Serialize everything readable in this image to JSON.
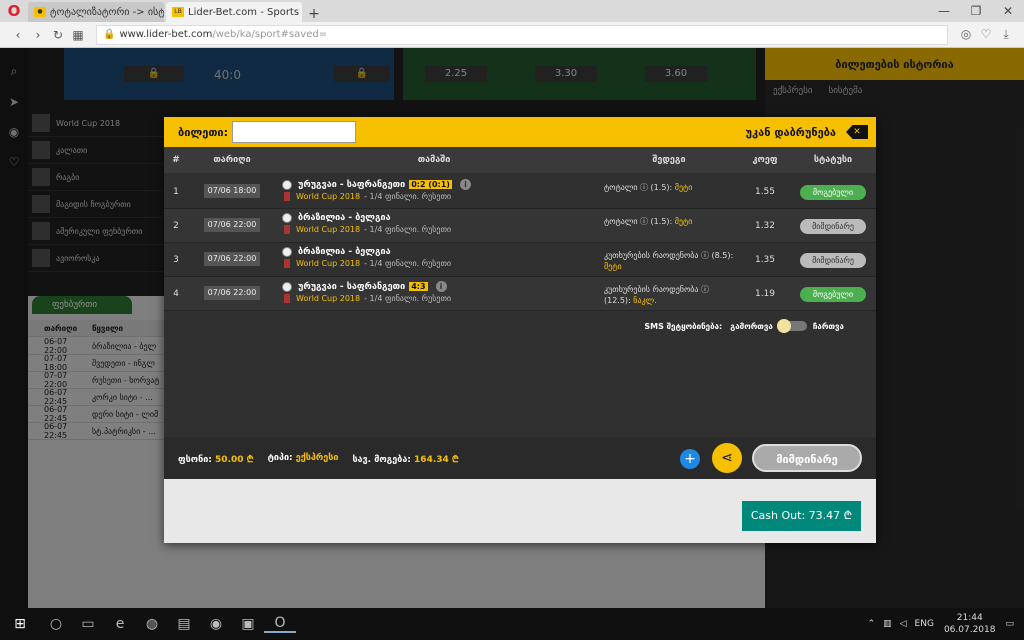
{
  "browser": {
    "tabs": [
      {
        "title": "ტოტალიზატორი -> ისტ",
        "active": false
      },
      {
        "title": "Lider-Bet.com - Sports and",
        "active": true
      }
    ],
    "url_host": "www.lider-bet.com",
    "url_path": "/web/ka/sport#saved="
  },
  "background": {
    "banner_left_score": "40:0",
    "banner_mid_odds": [
      "2.25",
      "3.30",
      "3.60"
    ],
    "ticket_history": "ბილეთების ისტორია",
    "right_tabs": [
      "ექსპრესი",
      "სისტემა"
    ],
    "sports": [
      "World Cup 2018",
      "კალათი",
      "რაგბი",
      "მაგიდის ჩოგბურთი",
      "ამერიკული ფეხბურთი",
      "ავიოროსკა"
    ],
    "football_tab": "ფეხბურთი",
    "table_head": [
      "თარიღი",
      "წყვილი"
    ],
    "rows": [
      {
        "d": "06-07 22:00",
        "t": "ბრაზილია - ბელ"
      },
      {
        "d": "07-07 18:00",
        "t": "შვედეთი - ინგლ"
      },
      {
        "d": "07-07 22:00",
        "t": "რუსეთი - ხორვატ"
      },
      {
        "d": "06-07 22:45",
        "t": "კორკი სიტი - ..."
      },
      {
        "d": "06-07 22:45",
        "t": "დერი სიტი - ლიმ"
      },
      {
        "d": "06-07 22:45",
        "t": "სტ.პატრიკსი - ..."
      }
    ]
  },
  "modal": {
    "ticket_label": "ბილეთი:",
    "back_label": "უკან დაბრუნება",
    "columns": [
      "#",
      "თარიღი",
      "თამაში",
      "შედეგი",
      "კოეფ",
      "სტატუსი"
    ],
    "rows": [
      {
        "num": "1",
        "date": "07/06 18:00",
        "match": "ურუგვაი - საფრანგეთი",
        "score": "0:2 (0:1)",
        "league": "World Cup 2018",
        "round": "- 1/4 ფინალი. რუსეთი",
        "bet": "ტოტალი ⓘ (1.5):",
        "result": "მეტი",
        "odds": "1.55",
        "status": "მოგებული",
        "state": "won"
      },
      {
        "num": "2",
        "date": "07/06 22:00",
        "match": "ბრაზილია - ბელგია",
        "score": "",
        "league": "World Cup 2018",
        "round": "- 1/4 ფინალი. რუსეთი",
        "bet": "ტოტალი ⓘ (1.5):",
        "result": "მეტი",
        "odds": "1.32",
        "status": "მიმდინარე",
        "state": "pending"
      },
      {
        "num": "3",
        "date": "07/06 22:00",
        "match": "ბრაზილია - ბელგია",
        "score": "",
        "league": "World Cup 2018",
        "round": "- 1/4 ფინალი. რუსეთი",
        "bet": "კუთხურების რაოდენობა ⓘ (8.5):",
        "result": "მეტი",
        "odds": "1.35",
        "status": "მიმდინარე",
        "state": "pending"
      },
      {
        "num": "4",
        "date": "07/06 22:00",
        "match": "ურუგვაი - საფრანგეთი",
        "score": "4:3",
        "league": "World Cup 2018",
        "round": "- 1/4 ფინალი. რუსეთი",
        "bet": "კუთხურების რაოდენობა ⓘ (12.5):",
        "result": "ნაკლ.",
        "odds": "1.19",
        "status": "მოგებული",
        "state": "won"
      }
    ],
    "sms_label": "SMS შეტყობინება:",
    "sms_off": "გამორთვა",
    "sms_on": "ჩართვა",
    "stake_label": "ფსონი:",
    "stake_value": "50.00 ₾",
    "type_label": "ტიპი:",
    "type_value": "ექსპრესი",
    "win_label": "სავ. მოგება:",
    "win_value": "164.34 ₾",
    "overall_status": "მიმდინარე",
    "cashout": "Cash Out: 73.47 ₾"
  },
  "taskbar": {
    "lang": "ENG",
    "time": "21:44",
    "date": "06.07.2018"
  }
}
